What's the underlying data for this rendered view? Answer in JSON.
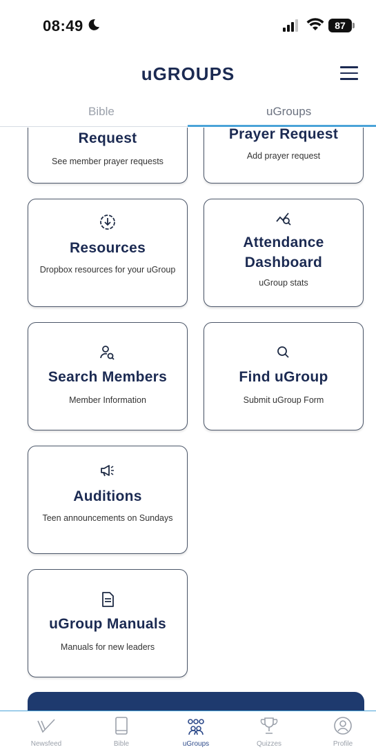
{
  "status_bar": {
    "time": "08:49",
    "battery": "87"
  },
  "header": {
    "title": "uGROUPS"
  },
  "tabs": [
    {
      "label": "Bible",
      "active": false
    },
    {
      "label": "uGroups",
      "active": true
    }
  ],
  "cards": [
    {
      "title": "Request",
      "subtitle": "See member prayer requests",
      "icon": "none"
    },
    {
      "title": "Prayer Request",
      "subtitle": "Add prayer request",
      "icon": "none"
    },
    {
      "title": "Resources",
      "subtitle": "Dropbox resources for your uGroup",
      "icon": "download-circle-icon"
    },
    {
      "title": "Attendance Dashboard",
      "subtitle": "uGroup stats",
      "icon": "chart-search-icon"
    },
    {
      "title": "Search Members",
      "subtitle": "Member Information",
      "icon": "person-search-icon"
    },
    {
      "title": "Find uGroup",
      "subtitle": "Submit uGroup Form",
      "icon": "magnifier-icon"
    },
    {
      "title": "Auditions",
      "subtitle": "Teen announcements on Sundays",
      "icon": "megaphone-icon"
    },
    {
      "title": "uGroup Manuals",
      "subtitle": "Manuals for new leaders",
      "icon": "document-icon"
    }
  ],
  "bottom_nav": [
    {
      "label": "Newsfeed",
      "icon": "newsfeed-icon",
      "active": false
    },
    {
      "label": "Bible",
      "icon": "book-icon",
      "active": false
    },
    {
      "label": "uGroups",
      "icon": "people-icon",
      "active": true
    },
    {
      "label": "Quizzes",
      "icon": "trophy-icon",
      "active": false
    },
    {
      "label": "Profile",
      "icon": "profile-icon",
      "active": false
    }
  ],
  "colors": {
    "primary": "#1b2a52",
    "accent": "#4aa3d8",
    "banner": "#1e3a6e"
  }
}
